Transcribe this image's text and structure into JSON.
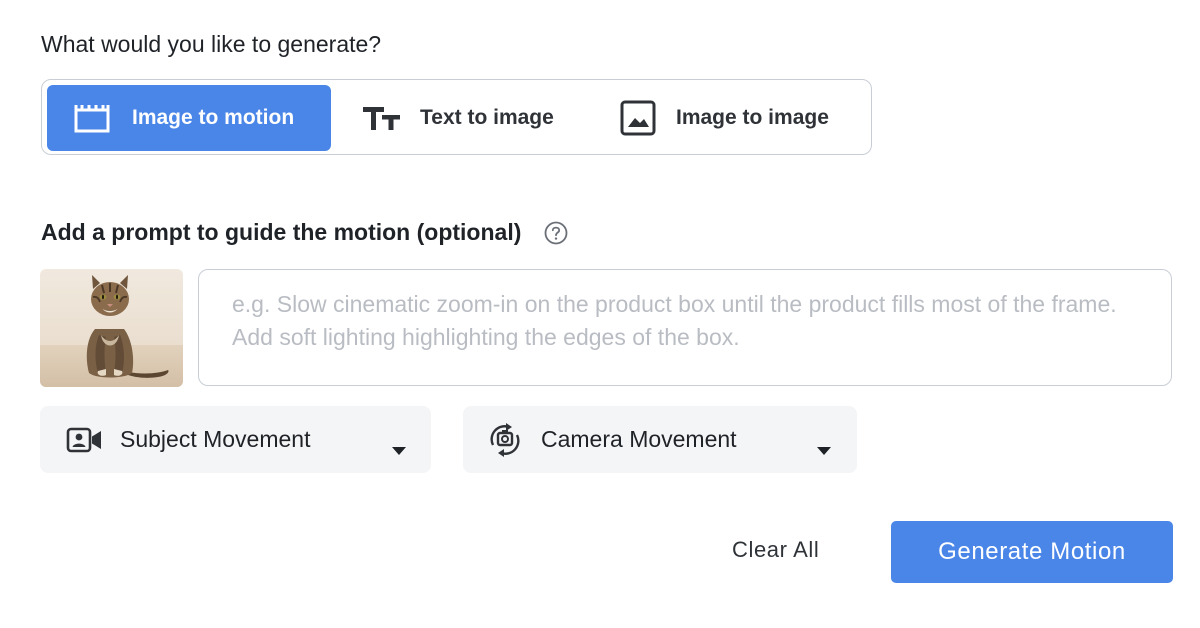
{
  "question": "What would you like to generate?",
  "modes": [
    {
      "label": "Image to motion",
      "icon": "clapperboard-icon",
      "active": true
    },
    {
      "label": "Text to image",
      "icon": "text-size-icon",
      "active": false
    },
    {
      "label": "Image to image",
      "icon": "image-icon",
      "active": false
    }
  ],
  "prompt": {
    "heading": "Add a prompt to guide the motion (optional)",
    "help_icon": "help-circle-icon",
    "placeholder": "e.g. Slow cinematic zoom-in on the product box until the product fills most of the frame. Add soft lighting highlighting the edges of the box.",
    "value": "",
    "thumbnail": "cat-photo"
  },
  "controls": {
    "subject_movement": {
      "label": "Subject Movement",
      "icon": "subject-camera-icon"
    },
    "camera_movement": {
      "label": "Camera Movement",
      "icon": "rotate-camera-icon"
    }
  },
  "actions": {
    "clear_label": "Clear All",
    "generate_label": "Generate Motion"
  },
  "colors": {
    "accent": "#4a86e8",
    "border": "#c9ced6",
    "dropdown_bg": "#f4f5f6",
    "placeholder": "#b9bdc3"
  }
}
